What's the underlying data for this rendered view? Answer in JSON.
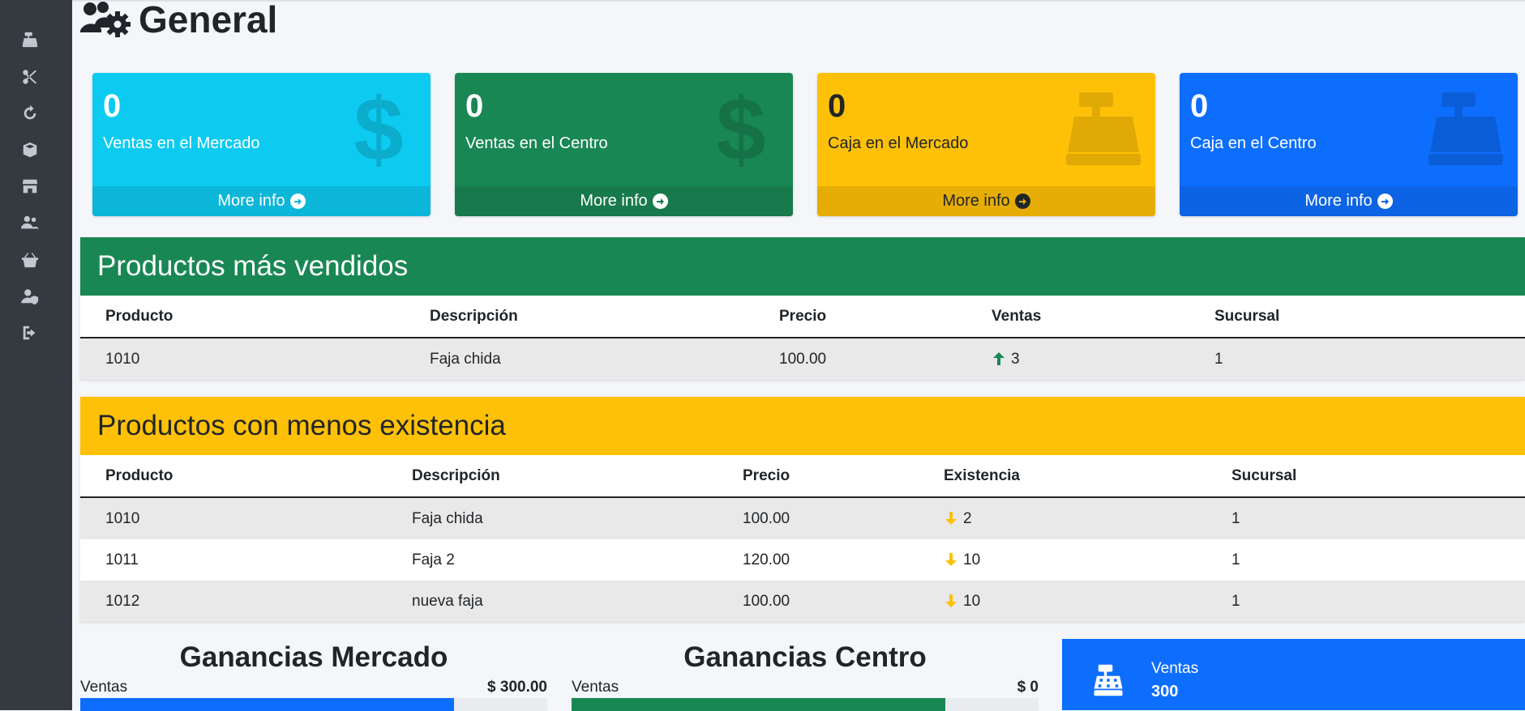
{
  "sidebar": {
    "items": [
      {
        "icon": "cash-register-icon"
      },
      {
        "icon": "scissors-icon"
      },
      {
        "icon": "refresh-icon"
      },
      {
        "icon": "box-icon"
      },
      {
        "icon": "store-icon"
      },
      {
        "icon": "users-icon"
      },
      {
        "icon": "basket-icon"
      },
      {
        "icon": "user-shield-icon"
      },
      {
        "icon": "logout-icon"
      }
    ]
  },
  "header": {
    "title": "General",
    "icon": "users-cog-icon"
  },
  "summary_cards": [
    {
      "value": "0",
      "label": "Ventas en el Mercado",
      "link": "More info",
      "icon": "dollar-icon",
      "color": "#0dcaf0"
    },
    {
      "value": "0",
      "label": "Ventas en el Centro",
      "link": "More info",
      "icon": "dollar-icon",
      "color": "#198754"
    },
    {
      "value": "0",
      "label": "Caja en el Mercado",
      "link": "More info",
      "icon": "cash-register-icon",
      "color": "#ffc107"
    },
    {
      "value": "0",
      "label": "Caja en el Centro",
      "link": "More info",
      "icon": "cash-register-icon",
      "color": "#0d6efd"
    }
  ],
  "top_products": {
    "title": "Productos más vendidos",
    "headers": [
      "Producto",
      "Descripción",
      "Precio",
      "Ventas",
      "Sucursal"
    ],
    "rows": [
      [
        "1010",
        "Faja chida",
        "100.00",
        "3",
        "1"
      ]
    ]
  },
  "low_stock": {
    "title": "Productos con menos existencia",
    "headers": [
      "Producto",
      "Descripción",
      "Precio",
      "Existencia",
      "Sucursal"
    ],
    "rows": [
      [
        "1010",
        "Faja chida",
        "100.00",
        "2",
        "1"
      ],
      [
        "1011",
        "Faja 2",
        "120.00",
        "10",
        "1"
      ],
      [
        "1012",
        "nueva faja",
        "100.00",
        "10",
        "1"
      ]
    ]
  },
  "ganancias_mercado": {
    "title": "Ganancias Mercado",
    "label": "Ventas",
    "amount": "$ 300.00",
    "progress": 0.8
  },
  "ganancias_centro": {
    "title": "Ganancias Centro",
    "label": "Ventas",
    "amount": "$ 0",
    "progress": 0.8
  },
  "ventas_box": {
    "label": "Ventas",
    "value": "300",
    "icon": "cash-register-icon"
  },
  "colors": {
    "blue": "#0d6efd",
    "green": "#198754",
    "yellow": "#ffc107",
    "cyan": "#0dcaf0",
    "sidebar": "#343a40"
  }
}
